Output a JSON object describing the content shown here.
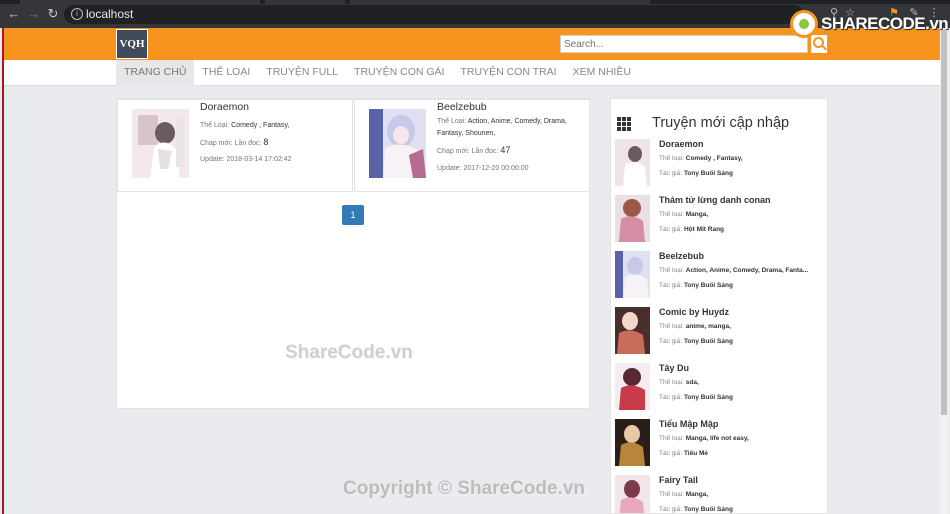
{
  "browser": {
    "url": "localhost",
    "back_icon": "arrow-left-icon",
    "forward_icon": "arrow-right-icon",
    "reload_icon": "reload-icon"
  },
  "watermark": {
    "logo_text": "SHARECODE.vn",
    "mid_text": "ShareCode.vn",
    "bottom_text": "Copyright © ShareCode.vn"
  },
  "site": {
    "logo_text": "VQH",
    "search_placeholder": "Search...",
    "colors": {
      "accent": "#f7941d",
      "border": "#a9161d",
      "pager": "#337ab7"
    }
  },
  "menu": [
    {
      "label": "TRANG CHỦ",
      "active": true
    },
    {
      "label": "THỂ LOẠI",
      "active": false
    },
    {
      "label": "TRUYỆN FULL",
      "active": false
    },
    {
      "label": "TRUYỆN CON GÁI",
      "active": false
    },
    {
      "label": "TRUYỆN CON TRAI",
      "active": false
    },
    {
      "label": "XEM NHIỀU",
      "active": false
    }
  ],
  "cards": [
    {
      "title": "Doraemon",
      "genre_label": "Thể Loại:",
      "genres": "Comedy , Fantasy,",
      "chap_label": "Chap mới: Lần đọc:",
      "reads": "8",
      "update_label": "Update:",
      "update": "2018-03-14 17:02:42"
    },
    {
      "title": "Beelzebub",
      "genre_label": "Thể Loại:",
      "genres": "Action, Anime, Comedy, Drama, Fantasy, Shounen,",
      "chap_label": "Chap mới: Lần đọc:",
      "reads": "47",
      "update_label": "Update:",
      "update": "2017-12-20 00:00:00"
    }
  ],
  "pager": {
    "current": "1"
  },
  "sidebar": {
    "title": "Truyện mới cập nhập",
    "genre_label": "Thể loại:",
    "author_label": "Tác giả:",
    "items": [
      {
        "name": "Doraemon",
        "genres": "Comedy , Fantasy,",
        "author": "Tony Buổi Sáng"
      },
      {
        "name": "Thám tử lừng danh conan",
        "genres": "Manga,",
        "author": "Hột Mít Rang"
      },
      {
        "name": "Beelzebub",
        "genres": "Action, Anime, Comedy, Drama, Fanta...",
        "author": "Tony Buổi Sáng"
      },
      {
        "name": "Comic by Huydz",
        "genres": "anime, manga,",
        "author": "Tony Buổi Sáng"
      },
      {
        "name": "Tây Du",
        "genres": "sda,",
        "author": "Tony Buổi Sáng"
      },
      {
        "name": "Tiểu Mập Mập",
        "genres": "Manga, life not easy,",
        "author": "Tiểu Mễ"
      },
      {
        "name": "Fairy Tail",
        "genres": "Manga,",
        "author": "Tony Buổi Sáng"
      }
    ]
  }
}
